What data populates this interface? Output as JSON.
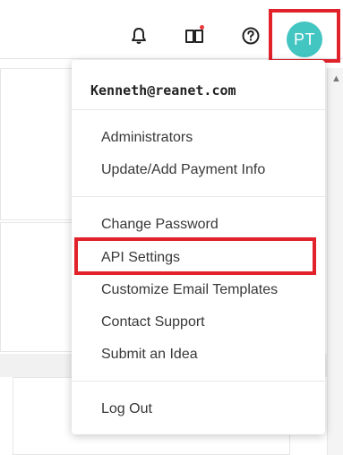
{
  "header": {
    "icons": [
      "bell-icon",
      "book-icon",
      "help-icon"
    ],
    "avatar_initials": "PT",
    "avatar_color": "#43c5c2",
    "notification_dot_color": "#e8393c"
  },
  "menu": {
    "email": "Kenneth@reanet.com",
    "group1": [
      "Administrators",
      "Update/Add Payment Info"
    ],
    "group2": [
      "Change Password",
      "API Settings",
      "Customize Email Templates",
      "Contact Support",
      "Submit an Idea"
    ],
    "group3": [
      "Log Out"
    ]
  },
  "highlight_color": "#e1222b"
}
